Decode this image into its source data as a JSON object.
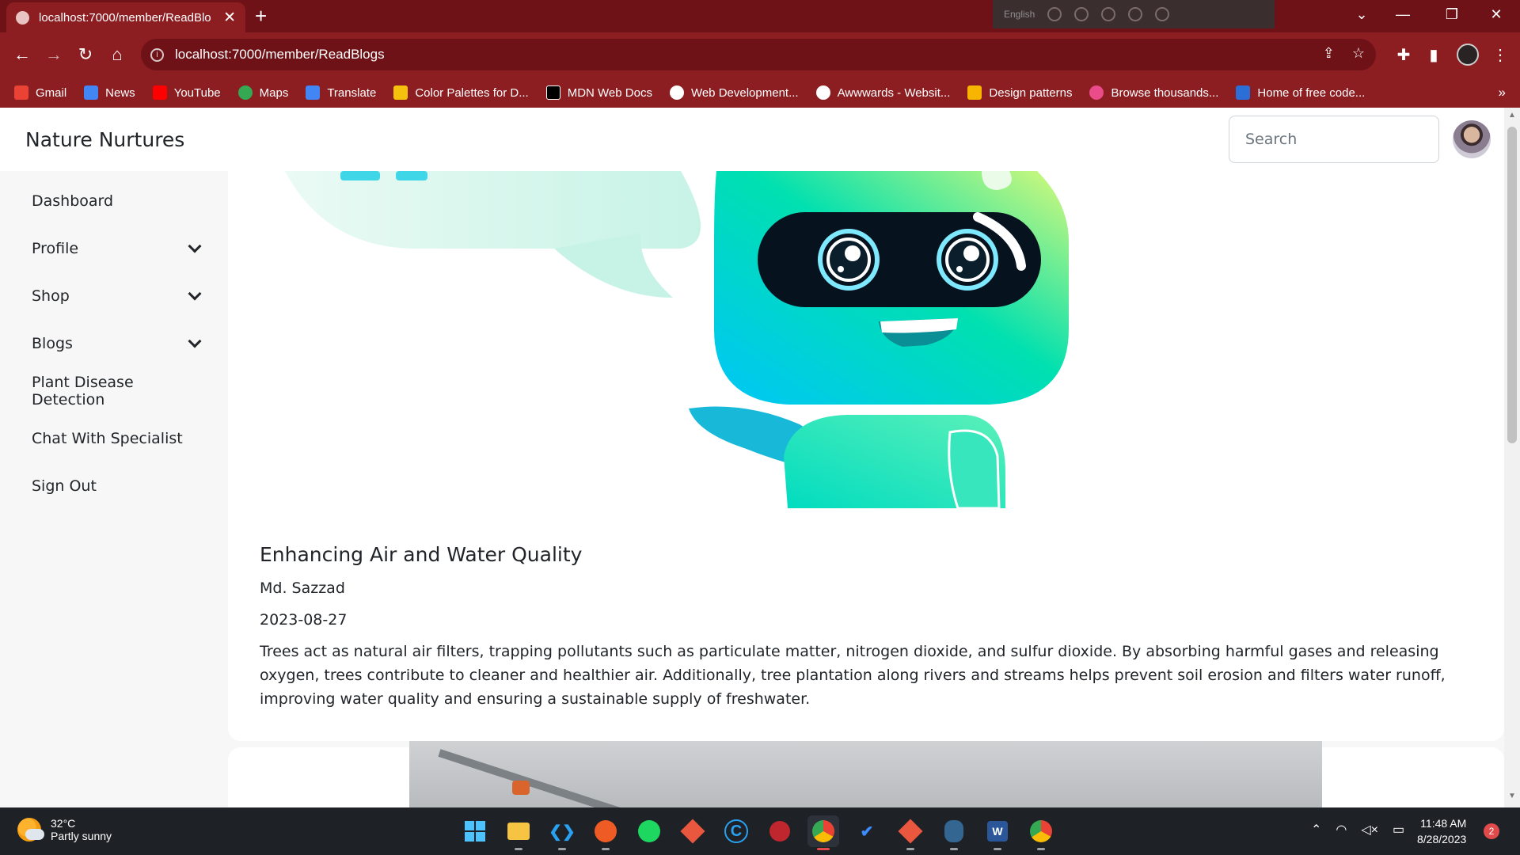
{
  "browser": {
    "tab_title": "localhost:7000/member/ReadBlo",
    "url": "localhost:7000/member/ReadBlogs",
    "ext_label": "English",
    "bookmarks": [
      {
        "label": "Gmail",
        "color": "#ea4335"
      },
      {
        "label": "News",
        "color": "#4285f4"
      },
      {
        "label": "YouTube",
        "color": "#ff0000"
      },
      {
        "label": "Maps",
        "color": "#34a853"
      },
      {
        "label": "Translate",
        "color": "#4285f4"
      },
      {
        "label": "Color Palettes for D...",
        "color": "#f4c20d"
      },
      {
        "label": "MDN Web Docs",
        "color": "#000000"
      },
      {
        "label": "Web Development...",
        "color": "#ffffff"
      },
      {
        "label": "Awwwards - Websit...",
        "color": "#ffffff"
      },
      {
        "label": "Design patterns",
        "color": "#f7b500"
      },
      {
        "label": "Browse thousands...",
        "color": "#ea4c89"
      },
      {
        "label": "Home of free code...",
        "color": "#2b6fd6"
      }
    ]
  },
  "app": {
    "brand": "Nature Nurtures",
    "search_placeholder": "Search",
    "sidebar": [
      {
        "label": "Dashboard",
        "dropdown": false
      },
      {
        "label": "Profile",
        "dropdown": true
      },
      {
        "label": "Shop",
        "dropdown": true
      },
      {
        "label": "Blogs",
        "dropdown": true
      },
      {
        "label": "Plant Disease Detection",
        "dropdown": false
      },
      {
        "label": "Chat With Specialist",
        "dropdown": false
      },
      {
        "label": "Sign Out",
        "dropdown": false
      }
    ]
  },
  "post": {
    "title": "Enhancing Air and Water Quality",
    "author": "Md. Sazzad",
    "date": "2023-08-27",
    "body": "Trees act as natural air filters, trapping pollutants such as particulate matter, nitrogen dioxide, and sulfur dioxide. By absorbing harmful gases and releasing oxygen, trees contribute to cleaner and healthier air. Additionally, tree plantation along rivers and streams helps prevent soil erosion and filters water runoff, improving water quality and ensuring a sustainable supply of freshwater."
  },
  "taskbar": {
    "temperature": "32°C",
    "weather": "Partly sunny",
    "time": "11:48 AM",
    "date": "8/28/2023",
    "notifications": "2"
  }
}
